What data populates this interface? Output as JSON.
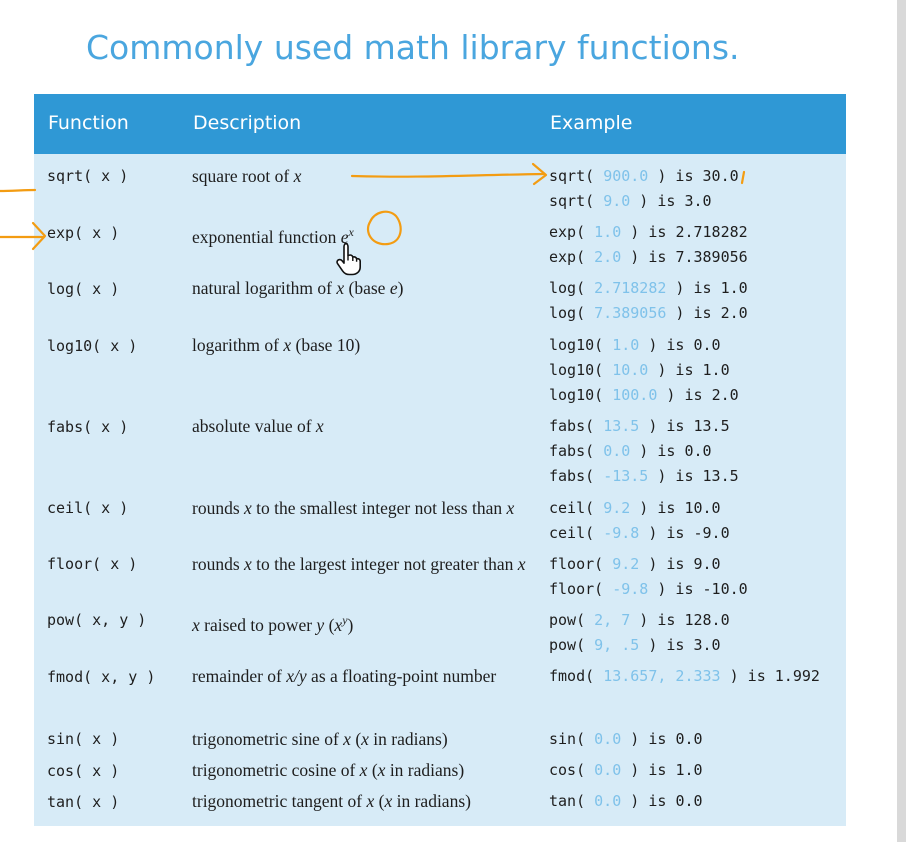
{
  "title": "Commonly used math library functions.",
  "header": {
    "function": "Function",
    "description": "Description",
    "example": "Example"
  },
  "rows": [
    {
      "fn": "sqrt( x )",
      "desc": [
        "square root of ",
        "x"
      ],
      "ex": [
        {
          "pre": "sqrt( ",
          "arg": "900.0",
          "post": " ) is ",
          "res": "30.0"
        },
        {
          "pre": "sqrt( ",
          "arg": "9.0",
          "post": " ) is ",
          "res": "3.0"
        }
      ]
    },
    {
      "fn": "exp( x )",
      "desc": [
        "exponential function ",
        "e",
        "x"
      ],
      "ex": [
        {
          "pre": "exp( ",
          "arg": "1.0",
          "post": " ) is ",
          "res": "2.718282"
        },
        {
          "pre": "exp( ",
          "arg": "2.0",
          "post": " ) is ",
          "res": "7.389056"
        }
      ]
    },
    {
      "fn": "log( x )",
      "desc": [
        "natural logarithm of ",
        "x",
        " (base ",
        "e",
        ")"
      ],
      "ex": [
        {
          "pre": "log( ",
          "arg": "2.718282",
          "post": " ) is ",
          "res": "1.0"
        },
        {
          "pre": "log( ",
          "arg": "7.389056",
          "post": "  ) is ",
          "res": "2.0"
        }
      ]
    },
    {
      "fn": "log10( x )",
      "desc": [
        "logarithm of ",
        "x",
        " (base 10)"
      ],
      "ex": [
        {
          "pre": "log10( ",
          "arg": "1.0",
          "post": " ) is ",
          "res": "0.0"
        },
        {
          "pre": "log10( ",
          "arg": "10.0",
          "post": " ) is ",
          "res": "1.0"
        },
        {
          "pre": "log10( ",
          "arg": "100.0",
          "post": " ) is ",
          "res": "2.0"
        }
      ]
    },
    {
      "fn": "fabs( x )",
      "desc": [
        "absolute value of ",
        "x"
      ],
      "ex": [
        {
          "pre": "fabs( ",
          "arg": "13.5",
          "post": " ) is ",
          "res": "13.5"
        },
        {
          "pre": "fabs( ",
          "arg": "0.0",
          "post": " ) is ",
          "res": "0.0"
        },
        {
          "pre": "fabs( ",
          "arg": "-13.5",
          "post": " ) is ",
          "res": "13.5"
        }
      ]
    },
    {
      "fn": "ceil( x )",
      "desc": [
        "rounds ",
        "x",
        " to the smallest integer not less than ",
        "x"
      ],
      "ex": [
        {
          "pre": "ceil( ",
          "arg": "9.2",
          "post": " ) is ",
          "res": "10.0"
        },
        {
          "pre": "ceil( ",
          "arg": "-9.8",
          "post": " ) is ",
          "res": "-9.0"
        }
      ]
    },
    {
      "fn": "floor( x )",
      "desc": [
        "rounds ",
        "x",
        " to the largest  integer not greater than ",
        "x"
      ],
      "ex": [
        {
          "pre": "floor( ",
          "arg": "9.2",
          "post": " ) is ",
          "res": "9.0"
        },
        {
          "pre": "floor( ",
          "arg": "-9.8",
          "post": " ) is ",
          "res": "-10.0"
        }
      ]
    },
    {
      "fn": "pow( x, y )",
      "desc": [
        "x",
        " raised to power ",
        "y",
        " (",
        "x",
        "y",
        ")"
      ],
      "ex": [
        {
          "pre": "pow( ",
          "arg": "2, 7",
          "post": " ) is ",
          "res": "128.0"
        },
        {
          "pre": "pow( ",
          "arg": "9, .5",
          "post": " ) is ",
          "res": "3.0"
        }
      ]
    },
    {
      "fn": "fmod( x, y )",
      "desc": [
        "remainder of ",
        "x/y",
        " as a floating-point number"
      ],
      "ex": [
        {
          "pre": "fmod( ",
          "arg": "13.657, 2.333",
          "post": " ) is ",
          "res": "1.992"
        }
      ]
    },
    {
      "fn": "sin( x )",
      "desc": [
        "trigonometric sine of ",
        "x",
        "  (",
        "x",
        " in radians)"
      ],
      "ex": [
        {
          "pre": "sin( ",
          "arg": "0.0",
          "post": " ) is ",
          "res": "0.0"
        }
      ]
    },
    {
      "fn": "cos( x )",
      "desc": [
        "trigonometric cosine of ",
        "x",
        " (",
        "x",
        " in radians)"
      ],
      "ex": [
        {
          "pre": "cos( ",
          "arg": "0.0",
          "post": " ) is ",
          "res": "1.0"
        }
      ]
    },
    {
      "fn": "tan( x )",
      "desc": [
        "trigonometric tangent of ",
        "x",
        " (",
        "x",
        " in radians)"
      ],
      "ex": [
        {
          "pre": "tan( ",
          "arg": "0.0",
          "post": " ) is ",
          "res": "0.0"
        }
      ]
    }
  ],
  "colors": {
    "title": "#4aa6df",
    "header": "#2f98d5",
    "body": "#d7ebf7",
    "arg": "#7fc2ea",
    "annotation": "#f39c12"
  },
  "icons": {
    "cursor": "hand-pointer-icon"
  }
}
